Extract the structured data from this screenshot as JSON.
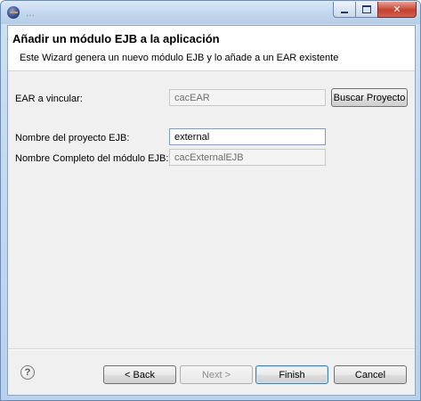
{
  "window": {
    "title": "...",
    "close_glyph": "✕"
  },
  "header": {
    "title": "Añadir un módulo EJB a la aplicación",
    "description": "Este Wizard genera un nuevo módulo EJB y lo añade a un EAR existente"
  },
  "form": {
    "ear_label": "EAR a vincular:",
    "ear_value": "cacEAR",
    "browse_button": "Buscar Proyecto",
    "project_label": "Nombre del proyecto EJB:",
    "project_value": "external",
    "module_label": "Nombre Completo del módulo EJB:",
    "module_value": "cacExternalEJB"
  },
  "footer": {
    "help_glyph": "?",
    "back_label": "< Back",
    "next_label": "Next >",
    "finish_label": "Finish",
    "cancel_label": "Cancel"
  },
  "icons": {
    "app": "eclipse-icon",
    "help": "help-icon",
    "minimize": "minimize-icon",
    "maximize": "maximize-icon",
    "close": "close-icon"
  }
}
